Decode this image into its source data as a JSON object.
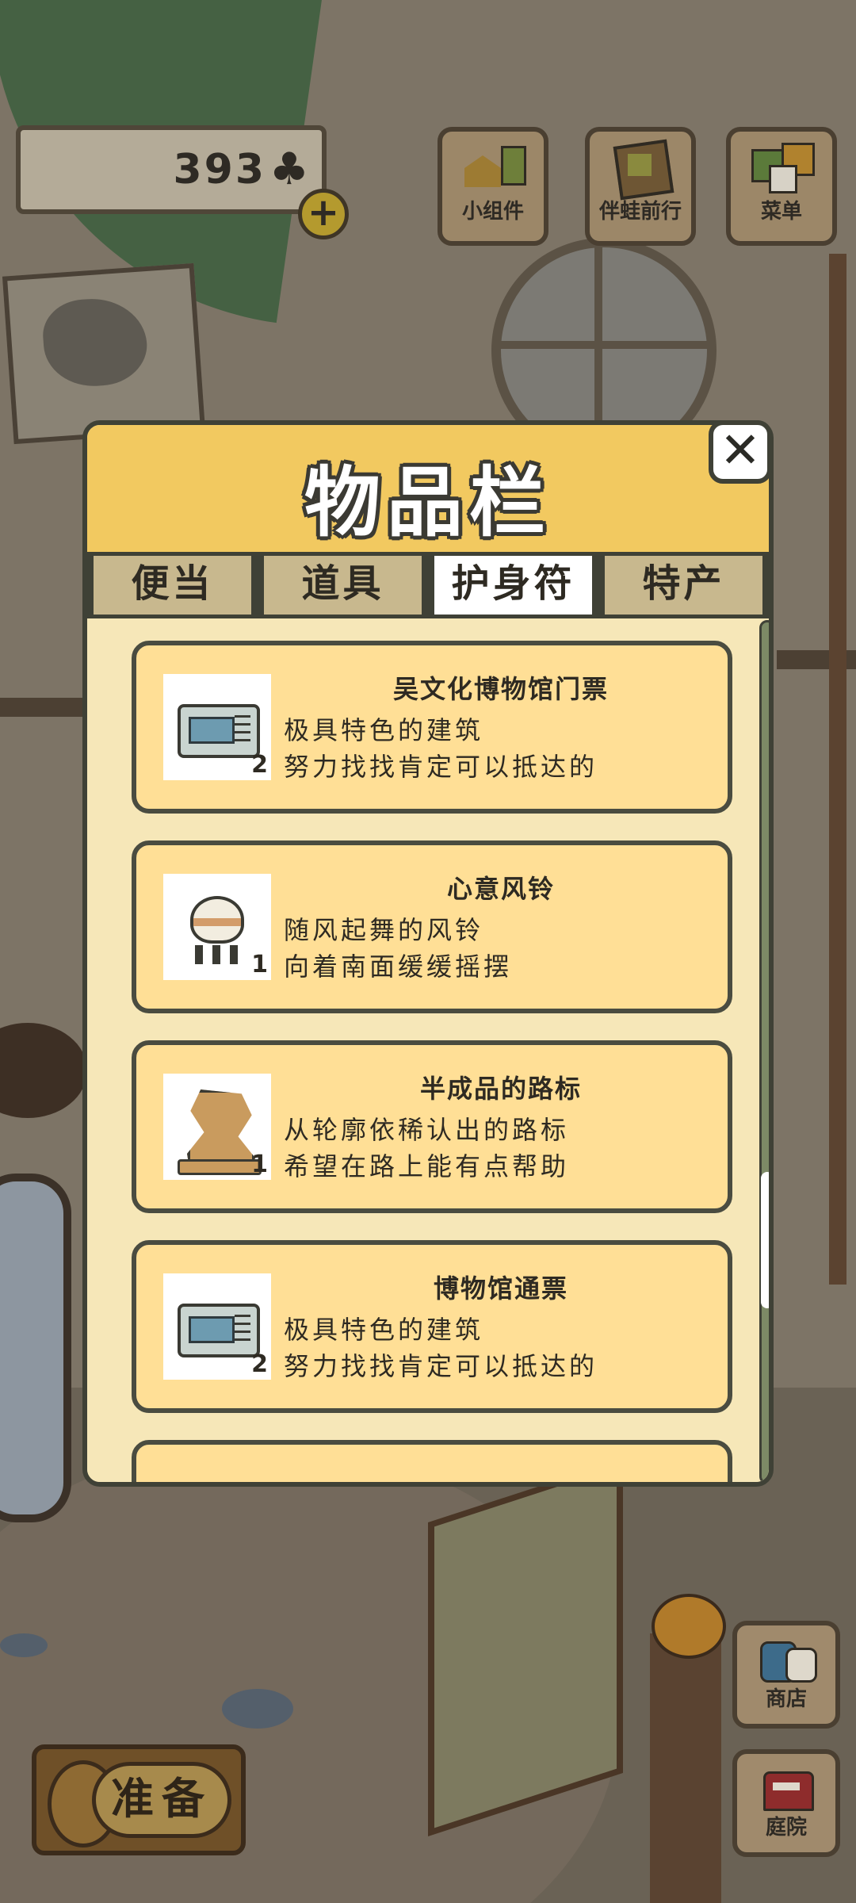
{
  "hud": {
    "clover_count": "393",
    "clover_icon": "clover-icon",
    "buttons": [
      {
        "label": "小组件",
        "icon": "widget-icon"
      },
      {
        "label": "伴蛙前行",
        "icon": "journey-book-icon"
      },
      {
        "label": "菜单",
        "icon": "menu-icon"
      }
    ]
  },
  "inventory": {
    "title": "物品栏",
    "tabs": [
      {
        "label": "便当",
        "active": false
      },
      {
        "label": "道具",
        "active": false
      },
      {
        "label": "护身符",
        "active": true
      },
      {
        "label": "特产",
        "active": false
      }
    ],
    "items": [
      {
        "name": "吴文化博物馆门票",
        "desc1": "极具特色的建筑",
        "desc2": "努力找找肯定可以抵达的",
        "qty": "2",
        "icon": "museum-ticket-icon"
      },
      {
        "name": "心意风铃",
        "desc1": "随风起舞的风铃",
        "desc2": "向着南面缓缓摇摆",
        "qty": "1",
        "icon": "wind-chime-icon"
      },
      {
        "name": "半成品的路标",
        "desc1": "从轮廓依稀认出的路标",
        "desc2": "希望在路上能有点帮助",
        "qty": "1",
        "icon": "signpost-stone-icon"
      },
      {
        "name": "博物馆通票",
        "desc1": "极具特色的建筑",
        "desc2": "努力找找肯定可以抵达的",
        "qty": "2",
        "icon": "museum-pass-icon"
      }
    ]
  },
  "bottom": {
    "ready_label": "准备",
    "shop_label": "商店",
    "yard_label": "庭院"
  },
  "colors": {
    "header_yellow": "#f2c960",
    "item_bg": "#ffdf96",
    "panel_bg": "#f6e7b8",
    "border_dark": "#3f4136"
  }
}
